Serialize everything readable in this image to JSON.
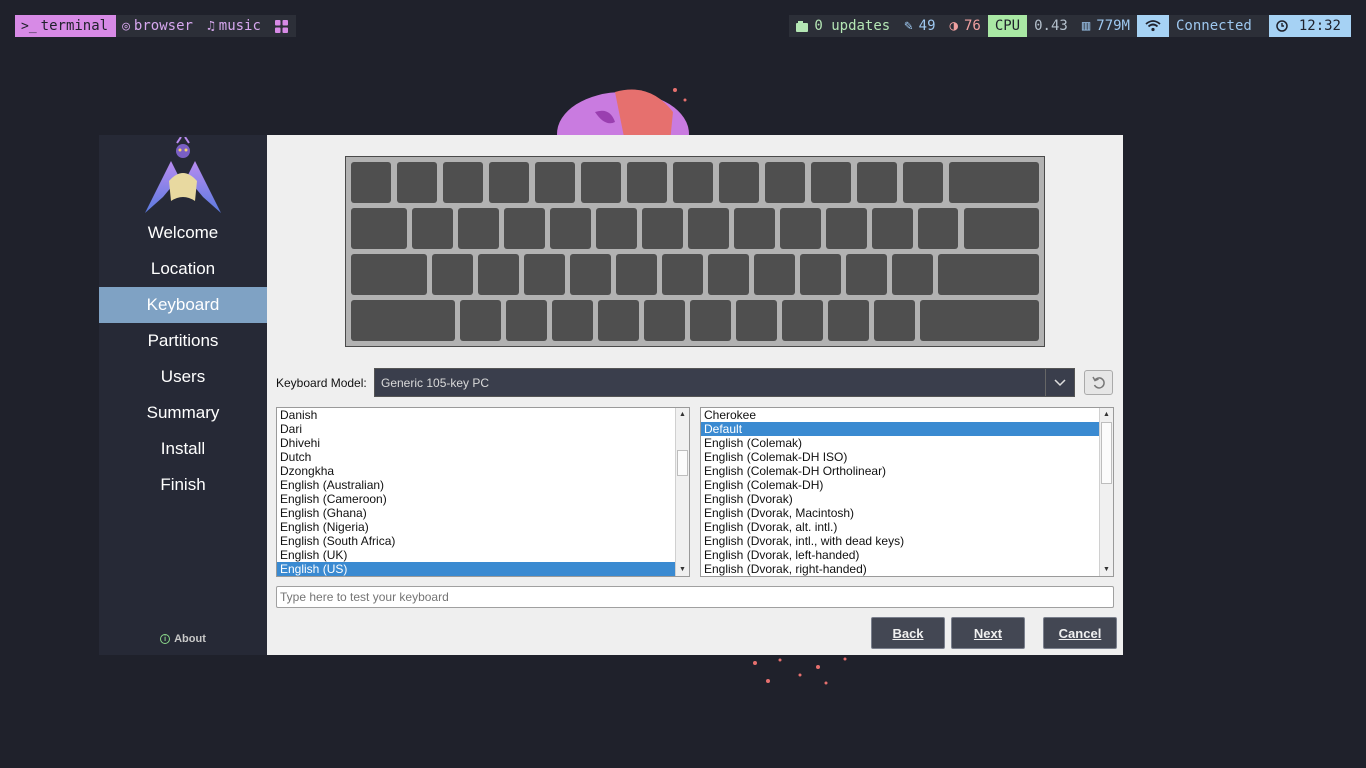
{
  "topbar": {
    "workspaces": [
      {
        "glyph": ">_",
        "label": "terminal",
        "active": true
      },
      {
        "glyph": "◎",
        "label": "browser",
        "active": false
      },
      {
        "glyph": "♫",
        "label": "music",
        "active": false
      }
    ],
    "grid_icon": "grid-icon",
    "updates": "0 updates",
    "brightness": "49",
    "contrast": "76",
    "cpu_label": "CPU",
    "cpu_value": "0.43",
    "memory": "779M",
    "wifi_status": "Connected",
    "time": "12:32"
  },
  "sidebar": {
    "items": [
      {
        "label": "Welcome",
        "active": false
      },
      {
        "label": "Location",
        "active": false
      },
      {
        "label": "Keyboard",
        "active": true
      },
      {
        "label": "Partitions",
        "active": false
      },
      {
        "label": "Users",
        "active": false
      },
      {
        "label": "Summary",
        "active": false
      },
      {
        "label": "Install",
        "active": false
      },
      {
        "label": "Finish",
        "active": false
      }
    ],
    "about_label": "About"
  },
  "keyboard": {
    "model_label": "Keyboard Model:",
    "model_value": "Generic 105-key PC",
    "layouts": [
      "Danish",
      "Dari",
      "Dhivehi",
      "Dutch",
      "Dzongkha",
      "English (Australian)",
      "English (Cameroon)",
      "English (Ghana)",
      "English (Nigeria)",
      "English (South Africa)",
      "English (UK)",
      "English (US)"
    ],
    "selected_layout": "English (US)",
    "variants": [
      "Cherokee",
      "Default",
      "English (Colemak)",
      "English (Colemak-DH ISO)",
      "English (Colemak-DH Ortholinear)",
      "English (Colemak-DH)",
      "English (Dvorak)",
      "English (Dvorak, Macintosh)",
      "English (Dvorak, alt. intl.)",
      "English (Dvorak, intl., with dead keys)",
      "English (Dvorak, left-handed)",
      "English (Dvorak, right-handed)"
    ],
    "selected_variant": "Default",
    "test_placeholder": "Type here to test your keyboard"
  },
  "buttons": {
    "back": "Back",
    "next": "Next",
    "cancel": "Cancel"
  },
  "colors": {
    "background": "#1f212b",
    "sidebar": "#262936",
    "sidebar_active": "#7fa2c4",
    "selection": "#3a8ad1",
    "workspace_active": "#d78ae6"
  }
}
